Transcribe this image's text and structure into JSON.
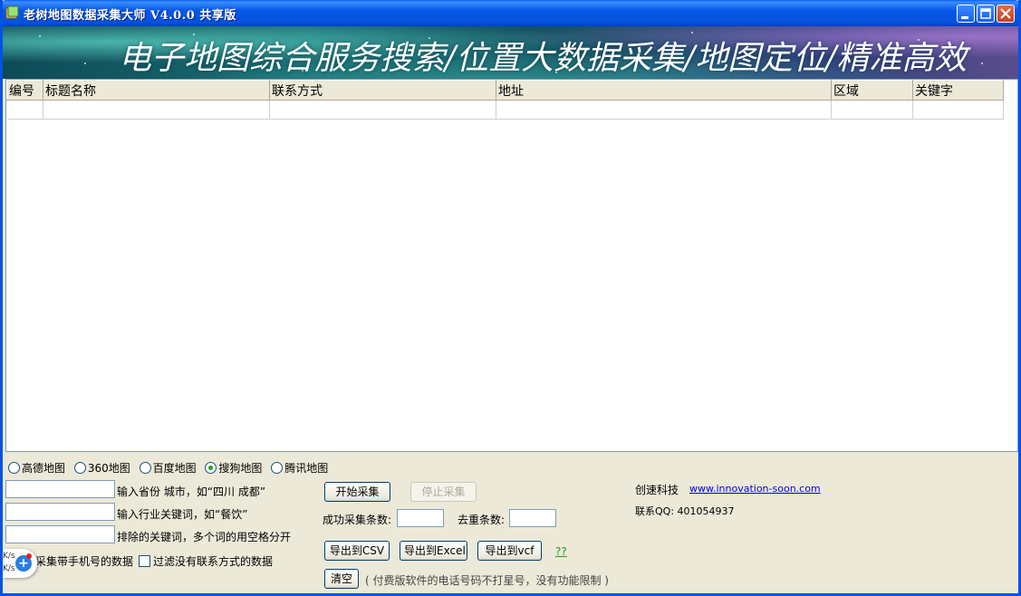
{
  "window": {
    "title": "老树地图数据采集大师 V4.0.0 共享版"
  },
  "banner": {
    "text": "电子地图综合服务搜索/位置大数据采集/地图定位/精准高效"
  },
  "table": {
    "columns": [
      "编号",
      "标题名称",
      "联系方式",
      "地址",
      "区域",
      "关键字"
    ],
    "rows": [
      [
        "",
        "",
        "",
        "",
        "",
        ""
      ]
    ]
  },
  "map_sources": {
    "options": [
      "高德地图",
      "360地图",
      "百度地图",
      "搜狗地图",
      "腾讯地图"
    ],
    "selected": "搜狗地图"
  },
  "inputs": {
    "city": {
      "value": "",
      "hint": "输入省份 城市，如“四川 成都”"
    },
    "keyword": {
      "value": "",
      "hint": "输入行业关键词，如“餐饮”"
    },
    "exclude": {
      "value": "",
      "hint": "排除的关键词，多个词的用空格分开"
    }
  },
  "options": {
    "mobile_only": {
      "label": "采集带手机号的数据",
      "checked": false
    },
    "filter_no_contact": {
      "label": "过滤没有联系方式的数据",
      "checked": false
    }
  },
  "actions": {
    "start": "开始采集",
    "stop": "停止采集",
    "success_count_label": "成功采集条数:",
    "success_count_value": "",
    "dedupe_count_label": "去重条数:",
    "dedupe_count_value": "",
    "export_csv": "导出到CSV",
    "export_excel": "导出到Excel",
    "export_vcf": "导出到vcf",
    "help": "??",
    "clear": "清空",
    "notice": "( 付费版软件的电话号码不打星号，没有功能限制 )"
  },
  "company": {
    "name": "创速科技",
    "website": "www.innovation-soon.com",
    "qq": "联系QQ: 401054937"
  },
  "float_widget": {
    "line1": "K/s",
    "line2": "K/s"
  }
}
